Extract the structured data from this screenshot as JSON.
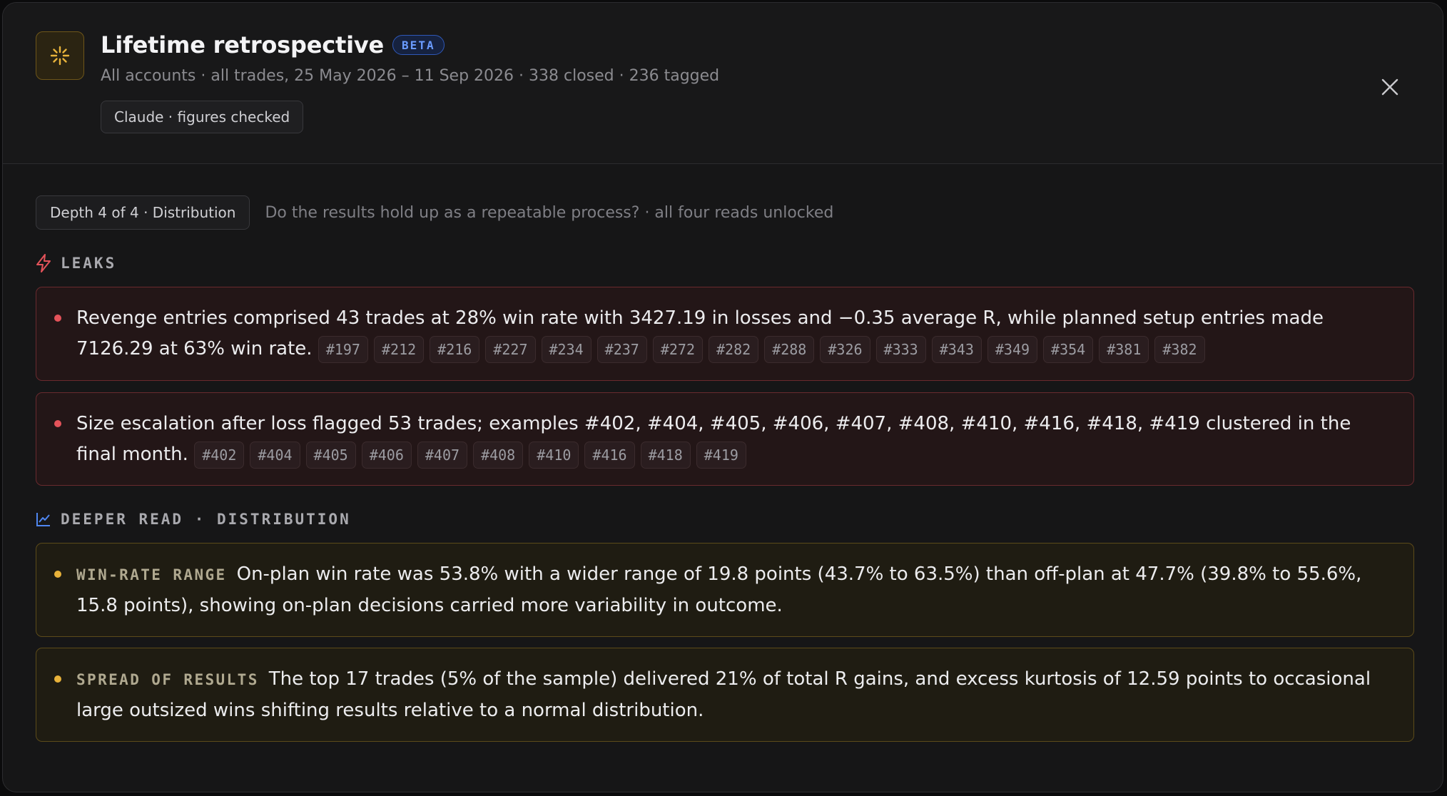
{
  "header": {
    "title": "Lifetime retrospective",
    "badge": "BETA",
    "subtitle": "All accounts · all trades, 25 May 2026 – 11 Sep 2026 · 338 closed · 236 tagged",
    "verified_chip": "Claude · figures checked",
    "icon": "sparkle-icon",
    "close_icon": "close-icon"
  },
  "depth": {
    "chip": "Depth 4 of 4 · Distribution",
    "description": "Do the results hold up as a repeatable process? · all four reads unlocked"
  },
  "leaks": {
    "label": "LEAKS",
    "icon": "lightning-icon",
    "items": [
      {
        "text": "Revenge entries comprised 43 trades at 28% win rate with 3427.19 in losses and −0.35 average R, while planned setup entries made 7126.29 at 63% win rate.",
        "tags": [
          "#197",
          "#212",
          "#216",
          "#227",
          "#234",
          "#237",
          "#272",
          "#282",
          "#288",
          "#326",
          "#333",
          "#343",
          "#349",
          "#354",
          "#381",
          "#382"
        ]
      },
      {
        "text": "Size escalation after loss flagged 53 trades; examples #402, #404, #405, #406, #407, #408, #410, #416, #418, #419 clustered in the final month.",
        "tags": [
          "#402",
          "#404",
          "#405",
          "#406",
          "#407",
          "#408",
          "#410",
          "#416",
          "#418",
          "#419"
        ]
      }
    ]
  },
  "deeper": {
    "label": "DEEPER READ · DISTRIBUTION",
    "icon": "line-chart-icon",
    "items": [
      {
        "kicker": "WIN-RATE RANGE",
        "text": "On-plan win rate was 53.8% with a wider range of 19.8 points (43.7% to 63.5%) than off-plan at 47.7% (39.8% to 55.6%, 15.8 points), showing on-plan decisions carried more variability in outcome."
      },
      {
        "kicker": "SPREAD OF RESULTS",
        "text": "The top 17 trades (5% of the sample) delivered 21% of total R gains, and excess kurtosis of 12.59 points to occasional large outsized wins shifting results relative to a normal distribution."
      }
    ]
  },
  "colors": {
    "leak_accent": "#e4535a",
    "deeper_accent": "#e8b23a",
    "beta_blue": "#6a9bff",
    "icon_gold": "#e9b43b"
  }
}
